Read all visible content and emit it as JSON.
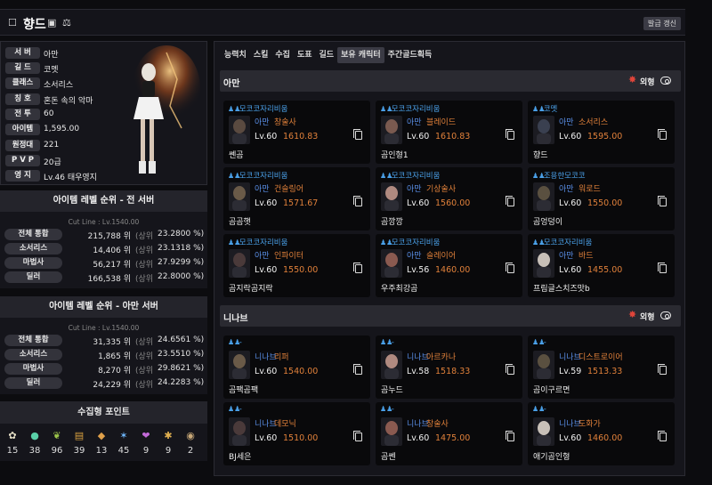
{
  "header": {
    "name": "향드",
    "refresh_label": "발급 갱신"
  },
  "profile": {
    "rows": [
      {
        "label": "서 버",
        "value": "아만"
      },
      {
        "label": "길 드",
        "value": "코멧"
      },
      {
        "label": "클래스",
        "value": "소서리스"
      },
      {
        "label": "칭 호",
        "value": "혼돈 속의 악마"
      },
      {
        "label": "전 투",
        "value": "60"
      },
      {
        "label": "아이템",
        "value": "1,595.00"
      },
      {
        "label": "원정대",
        "value": "221"
      },
      {
        "label": "P V P",
        "value": "20급"
      },
      {
        "label": "영 지",
        "value": "Lv.46 태우영지"
      }
    ]
  },
  "rank_all": {
    "title": "아이템 레벨 순위 - 전 서버",
    "cutline": "Cut Line : Lv.1540.00",
    "rows": [
      {
        "label": "전체 통합",
        "value": "215,788 위",
        "sub": "(상위",
        "pct": "23.2800 %)"
      },
      {
        "label": "소서리스",
        "value": "14,406 위",
        "sub": "(상위",
        "pct": "23.1318 %)"
      },
      {
        "label": "마법사",
        "value": "56,217 위",
        "sub": "(상위",
        "pct": "27.9299 %)"
      },
      {
        "label": "딜러",
        "value": "166,538 위",
        "sub": "(상위",
        "pct": "22.8000 %)"
      }
    ]
  },
  "rank_server": {
    "title": "아이템 레벨 순위 - 아만 서버",
    "cutline": "Cut Line : Lv.1540.00",
    "rows": [
      {
        "label": "전체 통합",
        "value": "31,335 위",
        "sub": "(상위",
        "pct": "24.6561 %)"
      },
      {
        "label": "소서리스",
        "value": "1,865 위",
        "sub": "(상위",
        "pct": "23.5510 %)"
      },
      {
        "label": "마법사",
        "value": "8,270 위",
        "sub": "(상위",
        "pct": "29.8621 %)"
      },
      {
        "label": "딜러",
        "value": "24,229 위",
        "sub": "(상위",
        "pct": "24.2283 %)"
      }
    ]
  },
  "collect": {
    "title": "수집형 포인트",
    "items": [
      {
        "icon": "mokoko-seed-icon",
        "count": "15"
      },
      {
        "icon": "island-heart-icon",
        "count": "38"
      },
      {
        "icon": "world-tree-leaf-icon",
        "count": "96"
      },
      {
        "icon": "art-piece-icon",
        "count": "39"
      },
      {
        "icon": "ignea-token-icon",
        "count": "13"
      },
      {
        "icon": "orpheus-star-icon",
        "count": "45"
      },
      {
        "icon": "giant-heart-icon",
        "count": "9"
      },
      {
        "icon": "sea-bounty-icon",
        "count": "9"
      },
      {
        "icon": "voyage-record-icon",
        "count": "2"
      }
    ]
  },
  "tabs": [
    "능력치",
    "스킬",
    "수집",
    "도표",
    "길드",
    "보유 캐릭터",
    "주간골드획득"
  ],
  "toggle_label": "외형",
  "servers": [
    {
      "name": "아만",
      "characters": [
        {
          "guild": "모코코자리비움",
          "server": "아만",
          "class": "창술사",
          "level": "Lv.60",
          "item_level": "1610.83",
          "name": "쎈곰"
        },
        {
          "guild": "모코코자리비움",
          "server": "아만",
          "class": "블레이드",
          "level": "Lv.60",
          "item_level": "1610.83",
          "name": "곰인형1"
        },
        {
          "guild": "코멧",
          "server": "아만",
          "class": "소서리스",
          "level": "Lv.60",
          "item_level": "1595.00",
          "name": "향드"
        },
        {
          "guild": "모코코자리비움",
          "server": "아만",
          "class": "건슬링어",
          "level": "Lv.60",
          "item_level": "1571.67",
          "name": "곰곰햇"
        },
        {
          "guild": "모코코자리비움",
          "server": "아만",
          "class": "기상술사",
          "level": "Lv.60",
          "item_level": "1560.00",
          "name": "곰깡깡"
        },
        {
          "guild": "조용한모코코",
          "server": "아만",
          "class": "워로드",
          "level": "Lv.60",
          "item_level": "1550.00",
          "name": "곰엉덩이"
        },
        {
          "guild": "모코코자리비움",
          "server": "아만",
          "class": "인파이터",
          "level": "Lv.60",
          "item_level": "1550.00",
          "name": "곰지락곰지락"
        },
        {
          "guild": "모코코자리비움",
          "server": "아만",
          "class": "슬레이어",
          "level": "Lv.56",
          "item_level": "1460.00",
          "name": "우주최강곰"
        },
        {
          "guild": "모코코자리비움",
          "server": "아만",
          "class": "바드",
          "level": "Lv.60",
          "item_level": "1455.00",
          "name": "프림글스치즈맛b"
        }
      ]
    },
    {
      "name": "니나브",
      "characters": [
        {
          "guild": "-",
          "server": "니나브",
          "class": "리퍼",
          "level": "Lv.60",
          "item_level": "1540.00",
          "name": "곰팩곰팩"
        },
        {
          "guild": "-",
          "server": "니나브",
          "class": "아르카나",
          "level": "Lv.58",
          "item_level": "1518.33",
          "name": "곰누드"
        },
        {
          "guild": "-",
          "server": "니나브",
          "class": "디스트로이어",
          "level": "Lv.59",
          "item_level": "1513.33",
          "name": "곰이구르면"
        },
        {
          "guild": "-",
          "server": "니나브",
          "class": "데모닉",
          "level": "Lv.60",
          "item_level": "1510.00",
          "name": "BJ세은"
        },
        {
          "guild": "-",
          "server": "니나브",
          "class": "창술사",
          "level": "Lv.60",
          "item_level": "1475.00",
          "name": "곰쎈"
        },
        {
          "guild": "-",
          "server": "니나브",
          "class": "도화가",
          "level": "Lv.60",
          "item_level": "1460.00",
          "name": "애기곰인형"
        }
      ]
    }
  ]
}
